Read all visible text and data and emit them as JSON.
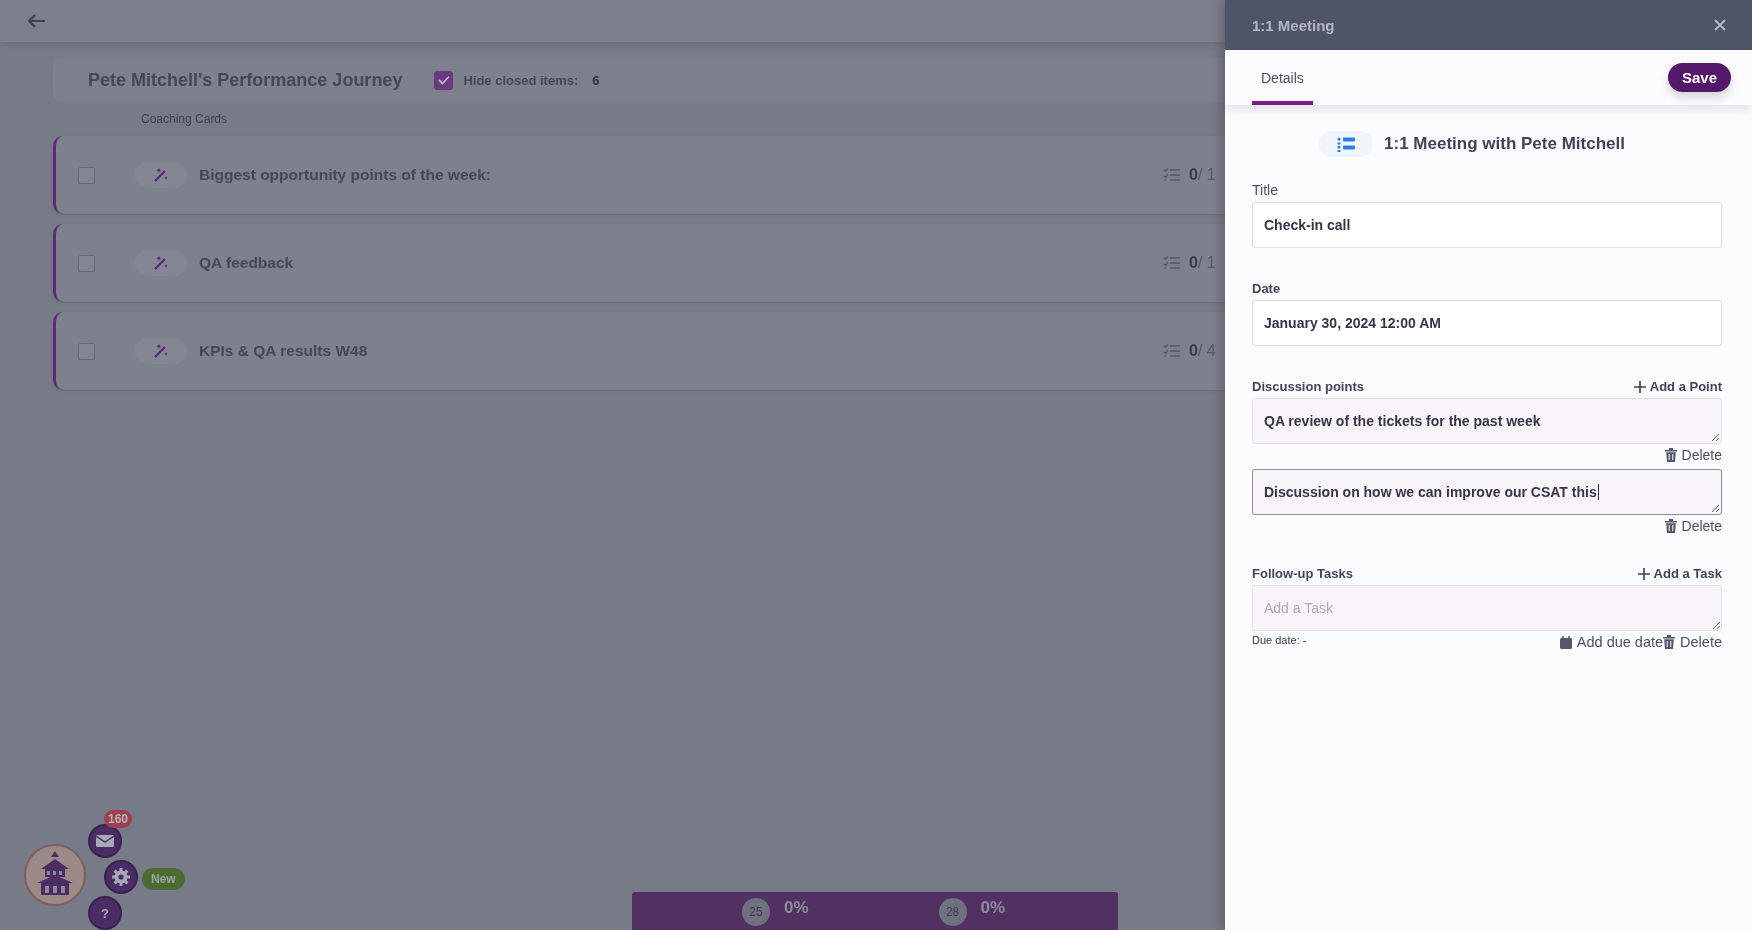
{
  "journey": {
    "title": "Pete Mitchell's Performance Journey",
    "hide_closed": {
      "label": "Hide closed items:",
      "checked": true,
      "count": "6"
    }
  },
  "section_label": "Coaching Cards",
  "cards": [
    {
      "title": "Biggest opportunity points of the week:",
      "checked": false,
      "done": "0",
      "total": "/ 1"
    },
    {
      "title": "QA feedback",
      "checked": false,
      "done": "0",
      "total": "/ 1"
    },
    {
      "title": "KPIs & QA results W48",
      "checked": false,
      "done": "0",
      "total": "/ 4"
    }
  ],
  "widget": {
    "mail_badge": "160",
    "new_badge": "New",
    "help_label": "?"
  },
  "progress_bar": {
    "items": [
      {
        "badge": "25",
        "percent": "0%"
      },
      {
        "badge": "28",
        "percent": "0%"
      }
    ]
  },
  "panel": {
    "title": "1:1 Meeting",
    "tabs": [
      {
        "label": "Details",
        "selected": true
      }
    ],
    "save": "Save",
    "heading": "1:1 Meeting with Pete Mitchell",
    "title_field": {
      "label": "Title",
      "value": "Check-in call"
    },
    "date_field": {
      "label": "Date",
      "value": "January 30, 2024 12:00 AM"
    },
    "discussion": {
      "label": "Discussion points",
      "add": "Add a Point",
      "points": [
        {
          "value": "QA review of the tickets for the past week",
          "focused": false,
          "delete": "Delete"
        },
        {
          "value": "Discussion on how we can improve our CSAT this ",
          "focused": true,
          "delete": "Delete"
        }
      ]
    },
    "tasks": {
      "label": "Follow-up Tasks",
      "add": "Add a Task",
      "items": [
        {
          "placeholder": "Add a Task",
          "due": "Due date: -",
          "add_due": "Add due date",
          "delete": "Delete"
        }
      ]
    }
  }
}
